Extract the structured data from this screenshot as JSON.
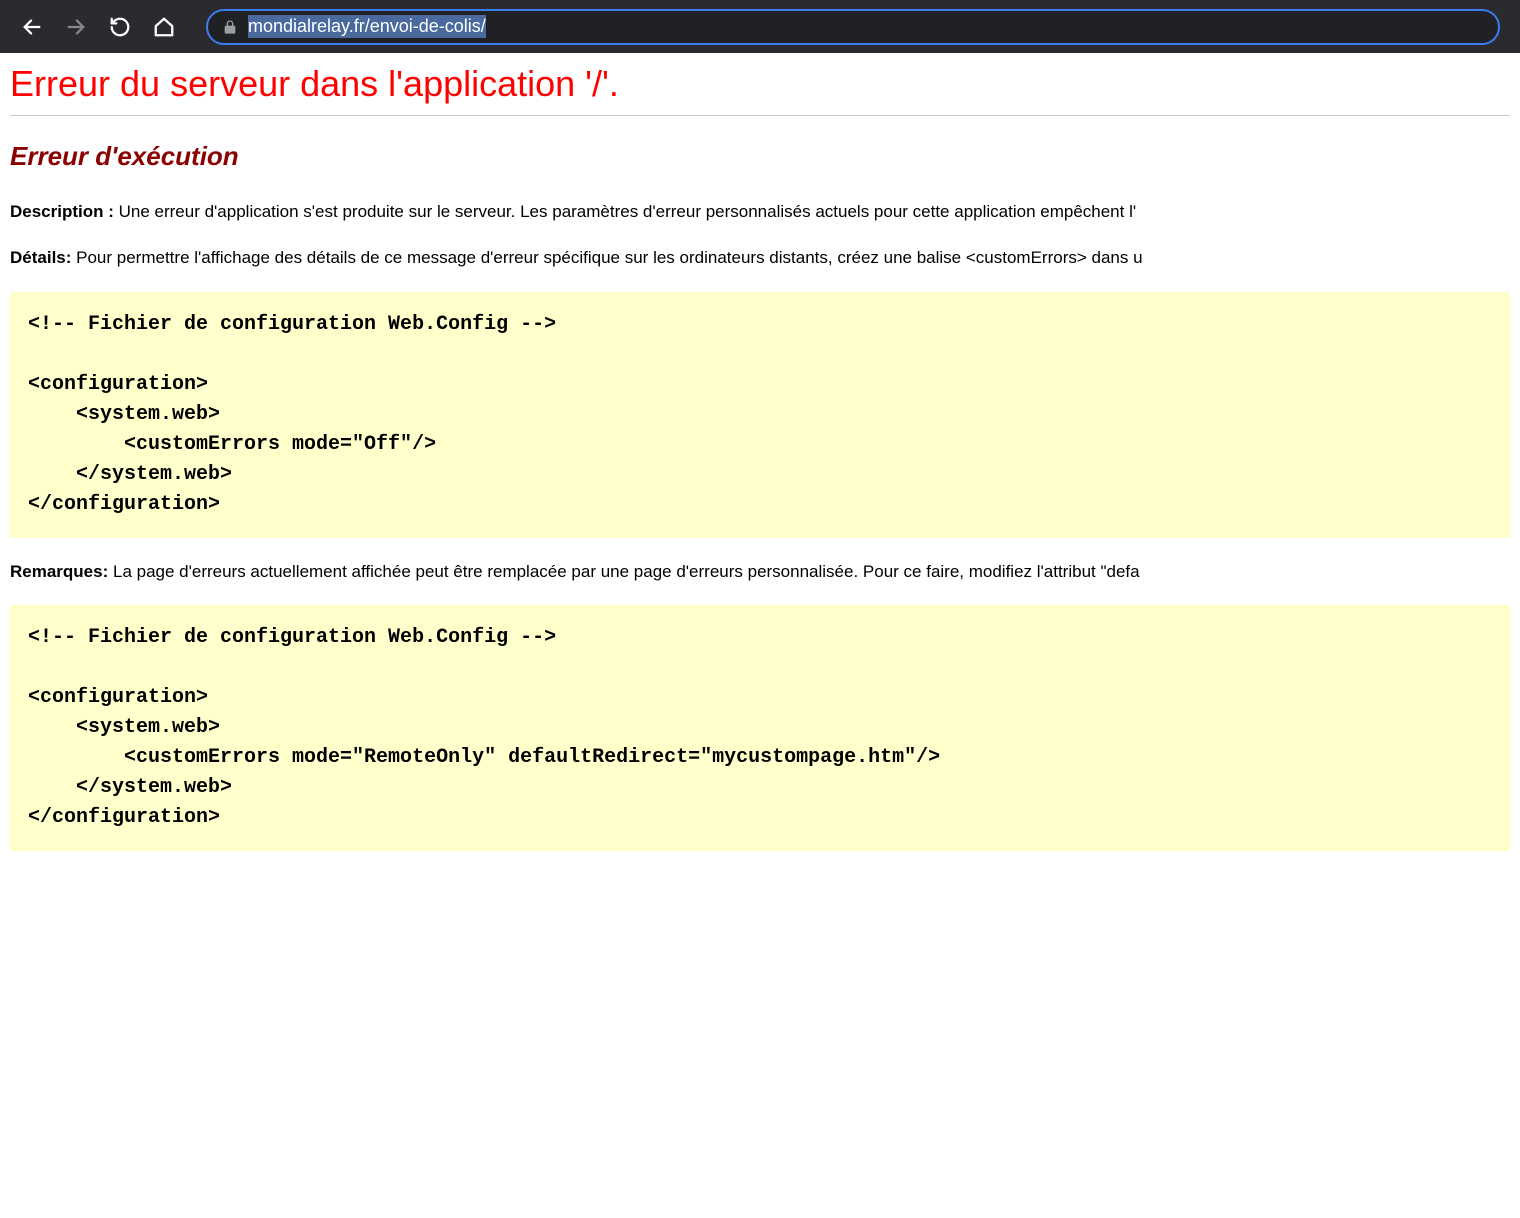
{
  "browser": {
    "url": "mondialrelay.fr/envoi-de-colis/"
  },
  "page": {
    "title": "Erreur du serveur dans l'application '/'.",
    "subtitle": "Erreur d'exécution",
    "description_label": "Description : ",
    "description_text": "Une erreur d'application s'est produite sur le serveur. Les paramètres d'erreur personnalisés actuels pour cette application empêchent l'",
    "details_label": "Détails: ",
    "details_text": "Pour permettre l'affichage des détails de ce message d'erreur spécifique sur les ordinateurs distants, créez une balise <customErrors> dans u",
    "code_block_1": "<!-- Fichier de configuration Web.Config -->\n\n<configuration>\n    <system.web>\n        <customErrors mode=\"Off\"/>\n    </system.web>\n</configuration>",
    "remarks_label": "Remarques: ",
    "remarks_text": "La page d'erreurs actuellement affichée peut être remplacée par une page d'erreurs personnalisée. Pour ce faire, modifiez l'attribut \"defa",
    "code_block_2": "<!-- Fichier de configuration Web.Config -->\n\n<configuration>\n    <system.web>\n        <customErrors mode=\"RemoteOnly\" defaultRedirect=\"mycustompage.htm\"/>\n    </system.web>\n</configuration>"
  }
}
